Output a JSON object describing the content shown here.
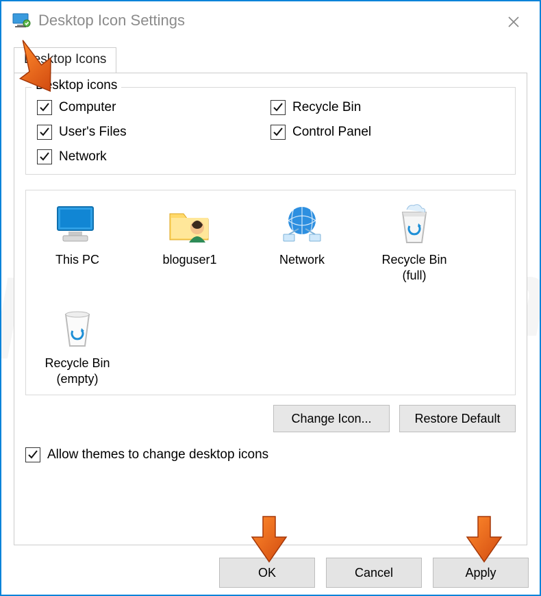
{
  "window": {
    "title": "Desktop Icon Settings"
  },
  "tab": {
    "label": "Desktop Icons"
  },
  "group": {
    "legend": "Desktop icons",
    "items": [
      {
        "label": "Computer",
        "checked": true
      },
      {
        "label": "User's Files",
        "checked": true
      },
      {
        "label": "Network",
        "checked": true
      },
      {
        "label": "Recycle Bin",
        "checked": true
      },
      {
        "label": "Control Panel",
        "checked": true
      }
    ]
  },
  "preview": {
    "items": [
      {
        "label": "This PC",
        "icon": "pc-icon"
      },
      {
        "label": "bloguser1",
        "icon": "user-folder-icon"
      },
      {
        "label": "Network",
        "icon": "network-icon"
      },
      {
        "label": "Recycle Bin\n(full)",
        "icon": "recycle-full-icon"
      },
      {
        "label": "Recycle Bin\n(empty)",
        "icon": "recycle-empty-icon"
      }
    ]
  },
  "buttons": {
    "change_icon": "Change Icon...",
    "restore_default": "Restore Default",
    "ok": "OK",
    "cancel": "Cancel",
    "apply": "Apply"
  },
  "themes_checkbox": {
    "label": "Allow themes to change desktop icons",
    "checked": true
  },
  "annotations": [
    {
      "target": "desktop-icons-group",
      "style": "arrow"
    },
    {
      "target": "ok-button",
      "style": "arrow"
    },
    {
      "target": "apply-button",
      "style": "arrow"
    }
  ]
}
